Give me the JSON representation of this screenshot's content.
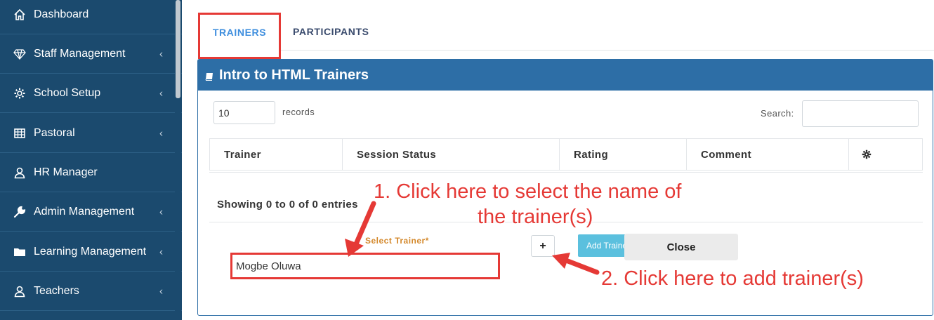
{
  "sidebar": {
    "items": [
      {
        "label": "Dashboard",
        "icon": "home-icon",
        "chevron": ""
      },
      {
        "label": "Staff Management",
        "icon": "diamond-icon",
        "chevron": "‹"
      },
      {
        "label": "School Setup",
        "icon": "gear-icon",
        "chevron": "‹"
      },
      {
        "label": "Pastoral",
        "icon": "table-icon",
        "chevron": "‹"
      },
      {
        "label": "HR Manager",
        "icon": "user-icon",
        "chevron": ""
      },
      {
        "label": "Admin Management",
        "icon": "wrench-icon",
        "chevron": "‹"
      },
      {
        "label": "Learning Management",
        "icon": "folder-icon",
        "chevron": "‹"
      },
      {
        "label": "Teachers",
        "icon": "teacher-icon",
        "chevron": "‹"
      }
    ]
  },
  "tabs": [
    {
      "label": "TRAINERS",
      "active": true
    },
    {
      "label": "PARTICIPANTS",
      "active": false
    }
  ],
  "panel": {
    "title": "Intro to HTML Trainers",
    "records_value": "10",
    "records_label": "records",
    "search_label": "Search:",
    "search_value": "",
    "columns": [
      "Trainer",
      "Session Status",
      "Rating",
      "Comment"
    ],
    "info": "Showing 0 to 0 of 0 entries",
    "select_label": "Select Trainer*",
    "selected_trainer": "Mogbe Oluwa",
    "plus_label": "+",
    "add_label": "Add Trainer",
    "close_label": "Close"
  },
  "annotations": {
    "step1_line1": "1. Click here to select the name of",
    "step1_line2": "the trainer(s)",
    "step2": "2. Click here to add trainer(s)"
  },
  "colors": {
    "sidebar_bg": "#1b4a6e",
    "panel_header": "#2d6ea6",
    "active_tab": "#3e8ede",
    "highlight_red": "#e53935",
    "select_label": "#d4892c",
    "add_button": "#5bc0de"
  }
}
